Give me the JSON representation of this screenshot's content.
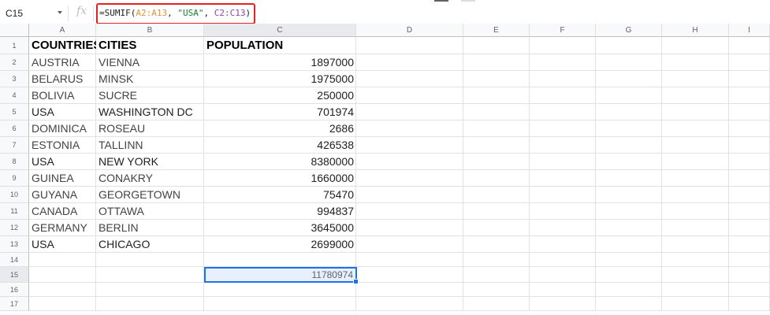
{
  "namebox": {
    "ref": "C15"
  },
  "formula_bar": {
    "fx_label": "fx",
    "prefix": "=SUMIF(",
    "range1": "A2:A13",
    "sep1": ", ",
    "criterion": "\"USA\"",
    "sep2": ", ",
    "range2": "C2:C13",
    "suffix": ")"
  },
  "columns": [
    "A",
    "B",
    "C",
    "D",
    "E",
    "F",
    "G",
    "H",
    "I"
  ],
  "rows": [
    "1",
    "2",
    "3",
    "4",
    "5",
    "6",
    "7",
    "8",
    "9",
    "10",
    "11",
    "12",
    "13",
    "14",
    "15",
    "16",
    "17"
  ],
  "headers": {
    "a": "COUNTRIES",
    "b": "CITIES",
    "c": "POPULATION"
  },
  "data": [
    {
      "country": "AUSTRIA",
      "city": "VIENNA",
      "population": "1897000"
    },
    {
      "country": "BELARUS",
      "city": "MINSK",
      "population": "1975000"
    },
    {
      "country": "BOLIVIA",
      "city": "SUCRE",
      "population": "250000"
    },
    {
      "country": "USA",
      "city": "WASHINGTON DC",
      "population": "701974"
    },
    {
      "country": "DOMINICA",
      "city": "ROSEAU",
      "population": "2686"
    },
    {
      "country": "ESTONIA",
      "city": "TALLINN",
      "population": "426538"
    },
    {
      "country": "USA",
      "city": "NEW YORK",
      "population": "8380000"
    },
    {
      "country": "GUINEA",
      "city": "CONAKRY",
      "population": "1660000"
    },
    {
      "country": "GUYANA",
      "city": "GEORGETOWN",
      "population": "75470"
    },
    {
      "country": "CANADA",
      "city": "OTTAWA",
      "population": "994837"
    },
    {
      "country": "GERMANY",
      "city": "BERLIN",
      "population": "3645000"
    },
    {
      "country": "USA",
      "city": "CHICAGO",
      "population": "2699000"
    }
  ],
  "result": {
    "value": "11780974"
  },
  "colors": {
    "selection": "#1a73e8",
    "highlight": "#e02424"
  }
}
